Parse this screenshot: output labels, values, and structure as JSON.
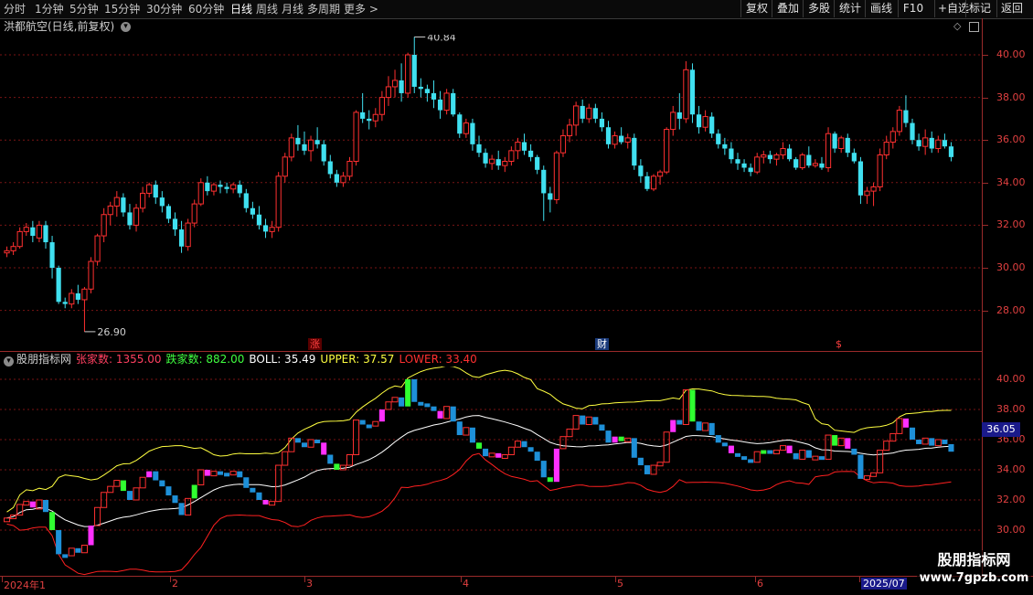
{
  "toolbar": {
    "periods": [
      "分时",
      "1分钟",
      "5分钟",
      "15分钟",
      "30分钟",
      "60分钟",
      "日线",
      "周线",
      "月线",
      "多周期",
      "更多 >"
    ],
    "selected": "日线",
    "buttons": [
      "复权",
      "叠加",
      "多股",
      "统计",
      "画线",
      "F10",
      "+自选",
      "返回"
    ],
    "mark_label": "标记"
  },
  "chart": {
    "title": "洪都航空(日线,前复权)",
    "high_label": "40.84",
    "low_label": "26.90",
    "price_axis": [
      "40.00",
      "38.00",
      "36.00",
      "34.00",
      "32.00",
      "30.00",
      "28.00"
    ],
    "markers": [
      {
        "text": "涨",
        "color": "#ff4040",
        "bg": "#5a0000"
      },
      {
        "text": "财",
        "color": "#ffffff",
        "bg": "#1a3a7a"
      },
      {
        "text": "$",
        "color": "#ff4040",
        "bg": "#000000"
      }
    ]
  },
  "indicator": {
    "name": "股朋指标网",
    "rise_label": "张家数: 1355.00",
    "fall_label": "跌家数: 882.00",
    "boll_label": "BOLL: 35.49",
    "upper_label": "UPPER: 37.57",
    "lower_label": "LOWER: 33.40",
    "axis": [
      "40.00",
      "38.00",
      "36.00",
      "34.00",
      "32.00",
      "30.00"
    ],
    "last_value": "36.05"
  },
  "dates": [
    "2024年1",
    "2",
    "3",
    "4",
    "5",
    "6",
    "2025/07"
  ],
  "watermark": {
    "line1": "股朋指标网",
    "line2": "www.7gpzb.com"
  },
  "colors": {
    "up": "#ff3030",
    "down": "#40e0f0",
    "boll_mid": "#ffffff",
    "boll_upper": "#ffff40",
    "boll_lower": "#ff2020",
    "grid": "#7a1515",
    "axis_text": "#e04040"
  },
  "chart_data": {
    "type": "candlestick",
    "ylim": [
      26.5,
      41.5
    ],
    "candles": [
      [
        30.7,
        31.0,
        30.5,
        30.8
      ],
      [
        30.8,
        31.2,
        30.6,
        31.0
      ],
      [
        31.0,
        31.9,
        30.9,
        31.7
      ],
      [
        31.7,
        32.1,
        31.5,
        31.9
      ],
      [
        31.9,
        32.2,
        31.2,
        31.5
      ],
      [
        31.4,
        32.2,
        31.2,
        32.0
      ],
      [
        32.0,
        32.2,
        30.9,
        31.2
      ],
      [
        31.2,
        31.5,
        29.5,
        30.0
      ],
      [
        30.0,
        30.1,
        28.3,
        28.4
      ],
      [
        28.4,
        28.6,
        28.1,
        28.3
      ],
      [
        28.3,
        29.0,
        28.1,
        28.8
      ],
      [
        28.8,
        29.2,
        28.3,
        28.5
      ],
      [
        28.5,
        29.1,
        27.0,
        29.0
      ],
      [
        29.0,
        30.5,
        28.8,
        30.3
      ],
      [
        30.3,
        31.6,
        30.1,
        31.5
      ],
      [
        31.5,
        32.8,
        31.2,
        32.5
      ],
      [
        32.5,
        33.1,
        32.0,
        32.9
      ],
      [
        32.9,
        33.6,
        32.4,
        33.3
      ],
      [
        33.3,
        33.5,
        32.4,
        32.6
      ],
      [
        32.6,
        33.0,
        31.8,
        32.0
      ],
      [
        32.0,
        33.0,
        31.7,
        32.8
      ],
      [
        32.8,
        33.8,
        32.6,
        33.5
      ],
      [
        33.5,
        34.0,
        33.3,
        33.9
      ],
      [
        33.9,
        34.1,
        33.0,
        33.3
      ],
      [
        33.3,
        33.6,
        32.6,
        32.9
      ],
      [
        32.9,
        33.0,
        32.1,
        32.3
      ],
      [
        32.3,
        32.6,
        31.5,
        31.8
      ],
      [
        31.8,
        32.2,
        30.7,
        31.0
      ],
      [
        31.0,
        32.3,
        30.8,
        32.1
      ],
      [
        32.1,
        33.2,
        31.9,
        33.0
      ],
      [
        33.0,
        34.2,
        32.9,
        34.0
      ],
      [
        34.0,
        34.3,
        33.4,
        33.6
      ],
      [
        33.6,
        34.0,
        33.4,
        33.9
      ],
      [
        33.9,
        34.1,
        33.5,
        33.8
      ],
      [
        33.8,
        34.0,
        33.5,
        33.7
      ],
      [
        33.7,
        34.0,
        33.5,
        33.9
      ],
      [
        33.9,
        34.1,
        33.3,
        33.5
      ],
      [
        33.5,
        33.7,
        32.6,
        32.8
      ],
      [
        32.8,
        33.1,
        32.3,
        32.5
      ],
      [
        32.5,
        32.9,
        31.8,
        32.0
      ],
      [
        32.0,
        32.3,
        31.4,
        31.7
      ],
      [
        31.7,
        32.2,
        31.4,
        31.9
      ],
      [
        31.9,
        34.5,
        31.7,
        34.3
      ],
      [
        34.3,
        35.4,
        34.0,
        35.2
      ],
      [
        35.2,
        36.3,
        35.0,
        36.1
      ],
      [
        36.1,
        36.7,
        35.5,
        35.8
      ],
      [
        35.8,
        36.4,
        35.3,
        35.5
      ],
      [
        35.5,
        36.2,
        35.0,
        36.0
      ],
      [
        36.0,
        36.6,
        35.6,
        35.8
      ],
      [
        35.8,
        36.0,
        34.8,
        35.0
      ],
      [
        35.0,
        35.3,
        34.2,
        34.4
      ],
      [
        34.4,
        34.6,
        33.8,
        34.0
      ],
      [
        34.0,
        34.5,
        33.8,
        34.3
      ],
      [
        34.3,
        35.2,
        34.1,
        35.0
      ],
      [
        35.0,
        37.4,
        34.8,
        37.3
      ],
      [
        37.3,
        38.2,
        36.8,
        37.0
      ],
      [
        37.0,
        37.4,
        36.5,
        36.9
      ],
      [
        36.9,
        37.5,
        36.6,
        37.2
      ],
      [
        37.2,
        38.3,
        36.9,
        38.0
      ],
      [
        38.0,
        39.0,
        37.6,
        38.5
      ],
      [
        38.5,
        39.3,
        38.0,
        38.8
      ],
      [
        38.8,
        39.6,
        37.8,
        38.2
      ],
      [
        38.2,
        40.1,
        38.0,
        40.0
      ],
      [
        40.0,
        40.84,
        38.2,
        38.5
      ],
      [
        38.5,
        38.9,
        38.0,
        38.4
      ],
      [
        38.4,
        38.6,
        37.8,
        38.2
      ],
      [
        38.2,
        38.8,
        37.5,
        37.9
      ],
      [
        37.9,
        38.3,
        37.0,
        37.4
      ],
      [
        37.4,
        38.4,
        37.2,
        38.2
      ],
      [
        38.2,
        38.4,
        37.1,
        37.2
      ],
      [
        37.2,
        37.3,
        36.1,
        36.3
      ],
      [
        36.3,
        37.0,
        36.1,
        36.8
      ],
      [
        36.8,
        37.0,
        35.5,
        35.8
      ],
      [
        35.8,
        36.2,
        35.2,
        35.4
      ],
      [
        35.4,
        35.6,
        34.7,
        34.9
      ],
      [
        34.9,
        35.3,
        34.6,
        35.1
      ],
      [
        35.1,
        35.5,
        34.6,
        34.8
      ],
      [
        34.8,
        35.2,
        34.5,
        35.0
      ],
      [
        35.0,
        35.7,
        34.8,
        35.5
      ],
      [
        35.5,
        36.1,
        35.1,
        35.9
      ],
      [
        35.9,
        36.3,
        35.3,
        35.5
      ],
      [
        35.5,
        35.8,
        35.0,
        35.2
      ],
      [
        35.2,
        35.3,
        34.4,
        34.6
      ],
      [
        34.6,
        34.8,
        32.2,
        33.5
      ],
      [
        33.5,
        33.8,
        32.6,
        33.2
      ],
      [
        33.2,
        35.5,
        33.0,
        35.4
      ],
      [
        35.4,
        36.5,
        35.2,
        36.2
      ],
      [
        36.2,
        37.0,
        35.9,
        36.7
      ],
      [
        36.7,
        37.8,
        36.2,
        37.6
      ],
      [
        37.6,
        37.9,
        36.8,
        37.0
      ],
      [
        37.0,
        37.7,
        36.8,
        37.5
      ],
      [
        37.5,
        37.7,
        36.8,
        37.0
      ],
      [
        37.0,
        37.3,
        36.4,
        36.6
      ],
      [
        36.6,
        36.9,
        35.6,
        35.8
      ],
      [
        35.8,
        36.4,
        35.6,
        36.2
      ],
      [
        36.2,
        36.6,
        35.8,
        35.9
      ],
      [
        35.9,
        36.3,
        35.6,
        36.1
      ],
      [
        36.1,
        36.3,
        34.6,
        34.8
      ],
      [
        34.8,
        35.1,
        34.0,
        34.3
      ],
      [
        34.3,
        34.5,
        33.6,
        33.7
      ],
      [
        33.7,
        34.4,
        33.6,
        34.3
      ],
      [
        34.3,
        34.6,
        33.9,
        34.5
      ],
      [
        34.5,
        36.6,
        34.4,
        36.5
      ],
      [
        36.5,
        37.6,
        36.2,
        37.3
      ],
      [
        37.3,
        38.2,
        36.5,
        37.0
      ],
      [
        37.0,
        39.7,
        36.8,
        39.3
      ],
      [
        39.3,
        39.6,
        36.8,
        37.2
      ],
      [
        37.2,
        37.6,
        36.3,
        36.6
      ],
      [
        36.6,
        37.4,
        36.4,
        37.1
      ],
      [
        37.1,
        37.3,
        36.1,
        36.3
      ],
      [
        36.3,
        36.5,
        35.6,
        35.8
      ],
      [
        35.8,
        36.1,
        35.3,
        35.6
      ],
      [
        35.6,
        35.9,
        34.9,
        35.1
      ],
      [
        35.1,
        35.4,
        34.6,
        34.9
      ],
      [
        34.9,
        35.1,
        34.5,
        34.7
      ],
      [
        34.7,
        34.9,
        34.3,
        34.5
      ],
      [
        34.5,
        35.4,
        34.4,
        35.2
      ],
      [
        35.2,
        35.5,
        34.9,
        35.3
      ],
      [
        35.3,
        35.5,
        34.9,
        35.1
      ],
      [
        35.1,
        35.4,
        34.8,
        35.3
      ],
      [
        35.3,
        35.9,
        35.1,
        35.6
      ],
      [
        35.6,
        35.8,
        35.0,
        35.1
      ],
      [
        35.1,
        35.2,
        34.6,
        34.7
      ],
      [
        34.7,
        35.4,
        34.6,
        35.3
      ],
      [
        35.3,
        35.7,
        34.7,
        34.8
      ],
      [
        34.8,
        35.1,
        34.7,
        34.9
      ],
      [
        34.9,
        35.2,
        34.6,
        34.7
      ],
      [
        34.7,
        36.6,
        34.5,
        36.3
      ],
      [
        36.3,
        36.4,
        35.4,
        35.6
      ],
      [
        35.6,
        36.2,
        35.4,
        36.1
      ],
      [
        36.1,
        36.3,
        35.2,
        35.4
      ],
      [
        35.4,
        35.6,
        34.9,
        35.0
      ],
      [
        35.0,
        35.2,
        33.0,
        33.4
      ],
      [
        33.4,
        33.8,
        33.0,
        33.6
      ],
      [
        33.6,
        34.0,
        32.9,
        33.8
      ],
      [
        33.8,
        35.6,
        33.6,
        35.3
      ],
      [
        35.3,
        36.2,
        35.1,
        35.9
      ],
      [
        35.9,
        36.6,
        35.6,
        36.4
      ],
      [
        36.4,
        37.6,
        36.2,
        37.4
      ],
      [
        37.4,
        38.1,
        36.6,
        36.8
      ],
      [
        36.8,
        37.0,
        35.8,
        36.0
      ],
      [
        36.0,
        36.3,
        35.5,
        35.7
      ],
      [
        35.7,
        36.5,
        35.3,
        36.1
      ],
      [
        36.1,
        36.4,
        35.4,
        35.6
      ],
      [
        35.6,
        36.2,
        35.4,
        36.0
      ],
      [
        36.0,
        36.3,
        35.6,
        35.7
      ],
      [
        35.7,
        35.9,
        35.0,
        35.2
      ]
    ],
    "boll": {
      "mid": 35.49,
      "upper": 37.57,
      "lower": 33.4
    }
  }
}
